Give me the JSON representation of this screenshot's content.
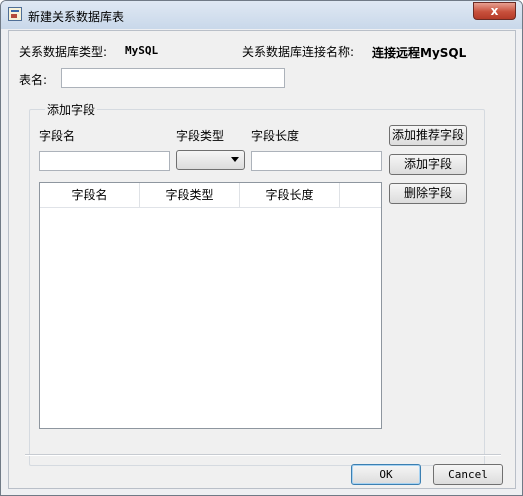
{
  "window": {
    "title": "新建关系数据库表",
    "close_symbol": "x",
    "icon": "database-table-icon"
  },
  "form": {
    "db_type_label": "关系数据库类型:",
    "db_type_value": "MySQL",
    "connection_name_label": "关系数据库连接名称:",
    "connection_name_value": "连接远程MySQL",
    "table_name_label": "表名:",
    "table_name_value": ""
  },
  "add_field_group": {
    "title": "添加字段",
    "field_name_label": "字段名",
    "field_type_label": "字段类型",
    "field_length_label": "字段长度",
    "field_name_value": "",
    "field_type_value": "",
    "field_length_value": ""
  },
  "buttons": {
    "add_recommended": "添加推荐字段",
    "add_field": "添加字段",
    "delete_field": "删除字段",
    "ok": "OK",
    "cancel": "Cancel"
  },
  "fields_table": {
    "columns": [
      "字段名",
      "字段类型",
      "字段长度",
      ""
    ],
    "rows": []
  }
}
